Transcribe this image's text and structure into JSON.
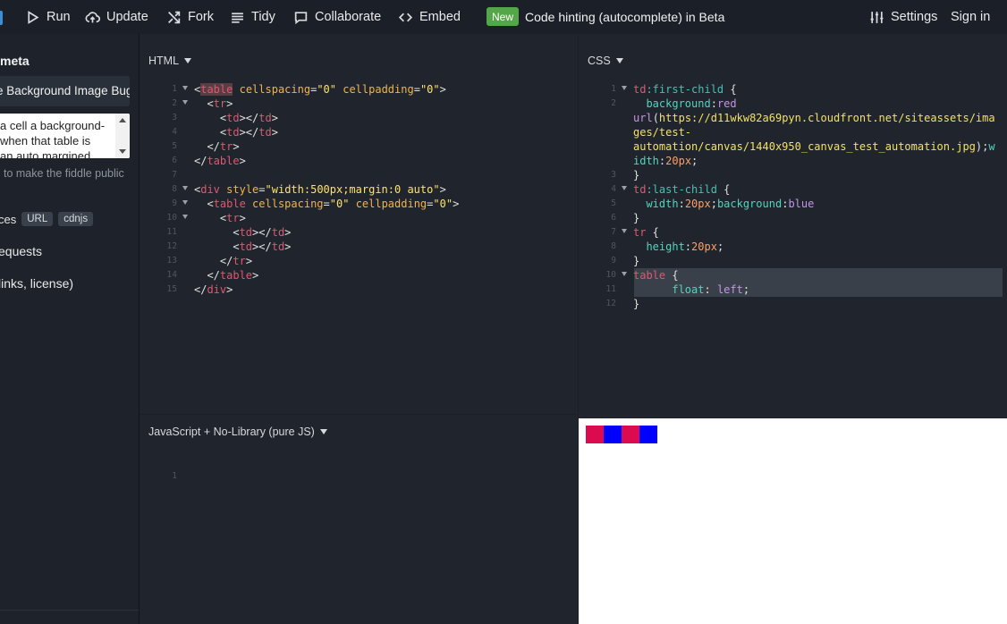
{
  "toolbar": {
    "run": "Run",
    "update": "Update",
    "fork": "Fork",
    "tidy": "Tidy",
    "collaborate": "Collaborate",
    "embed": "Embed",
    "new_badge": "New",
    "announcement": "Code hinting (autocomplete) in Beta",
    "settings": "Settings",
    "sign_in": "Sign in"
  },
  "sidebar": {
    "heading": "meta",
    "title_value": "e Background Image Bug",
    "description_lines": [
      "a cell a background-",
      "when that table is",
      "an auto margined"
    ],
    "public_note": "to make the fiddle public",
    "resources_label": "ces",
    "resource_chips": [
      "URL",
      "cdnjs"
    ],
    "requests": "equests",
    "links": "links, license)"
  },
  "html_panel": {
    "label": "HTML",
    "lines": [
      [
        [
          "t-plain",
          "<"
        ],
        [
          "t-tag hl-word",
          "table"
        ],
        [
          "t-plain",
          " "
        ],
        [
          "t-attr",
          "cellspacing"
        ],
        [
          "t-plain",
          "="
        ],
        [
          "t-str",
          "\"0\""
        ],
        [
          "t-plain",
          " "
        ],
        [
          "t-attr",
          "cellpadding"
        ],
        [
          "t-plain",
          "="
        ],
        [
          "t-str",
          "\"0\""
        ],
        [
          "t-plain",
          ">"
        ]
      ],
      [
        [
          "t-plain",
          "  <"
        ],
        [
          "t-tag",
          "tr"
        ],
        [
          "t-plain",
          ">"
        ]
      ],
      [
        [
          "t-plain",
          "    <"
        ],
        [
          "t-tag",
          "td"
        ],
        [
          "t-plain",
          "></"
        ],
        [
          "t-tag",
          "td"
        ],
        [
          "t-plain",
          ">"
        ]
      ],
      [
        [
          "t-plain",
          "    <"
        ],
        [
          "t-tag",
          "td"
        ],
        [
          "t-plain",
          "></"
        ],
        [
          "t-tag",
          "td"
        ],
        [
          "t-plain",
          ">"
        ]
      ],
      [
        [
          "t-plain",
          "  </"
        ],
        [
          "t-tag",
          "tr"
        ],
        [
          "t-plain",
          ">"
        ]
      ],
      [
        [
          "t-plain",
          "</"
        ],
        [
          "t-tag",
          "table"
        ],
        [
          "t-plain",
          ">"
        ]
      ],
      [],
      [
        [
          "t-plain",
          "<"
        ],
        [
          "t-tag",
          "div"
        ],
        [
          "t-plain",
          " "
        ],
        [
          "t-attr",
          "style"
        ],
        [
          "t-plain",
          "="
        ],
        [
          "t-str",
          "\"width:500px;margin:0 auto\""
        ],
        [
          "t-plain",
          ">"
        ]
      ],
      [
        [
          "t-plain",
          "  <"
        ],
        [
          "t-tag",
          "table"
        ],
        [
          "t-plain",
          " "
        ],
        [
          "t-attr",
          "cellspacing"
        ],
        [
          "t-plain",
          "="
        ],
        [
          "t-str",
          "\"0\""
        ],
        [
          "t-plain",
          " "
        ],
        [
          "t-attr",
          "cellpadding"
        ],
        [
          "t-plain",
          "="
        ],
        [
          "t-str",
          "\"0\""
        ],
        [
          "t-plain",
          ">"
        ]
      ],
      [
        [
          "t-plain",
          "    <"
        ],
        [
          "t-tag",
          "tr"
        ],
        [
          "t-plain",
          ">"
        ]
      ],
      [
        [
          "t-plain",
          "      <"
        ],
        [
          "t-tag",
          "td"
        ],
        [
          "t-plain",
          "></"
        ],
        [
          "t-tag",
          "td"
        ],
        [
          "t-plain",
          ">"
        ]
      ],
      [
        [
          "t-plain",
          "      <"
        ],
        [
          "t-tag",
          "td"
        ],
        [
          "t-plain",
          "></"
        ],
        [
          "t-tag",
          "td"
        ],
        [
          "t-plain",
          ">"
        ]
      ],
      [
        [
          "t-plain",
          "    </"
        ],
        [
          "t-tag",
          "tr"
        ],
        [
          "t-plain",
          ">"
        ]
      ],
      [
        [
          "t-plain",
          "  </"
        ],
        [
          "t-tag",
          "table"
        ],
        [
          "t-plain",
          ">"
        ]
      ],
      [
        [
          "t-plain",
          "</"
        ],
        [
          "t-tag",
          "div"
        ],
        [
          "t-plain",
          ">"
        ]
      ]
    ],
    "folds": [
      1,
      2,
      8,
      9,
      10
    ]
  },
  "css_panel": {
    "label": "CSS",
    "lines": [
      [
        [
          "t-sel",
          "td"
        ],
        [
          "t-pseudo",
          ":first-child"
        ],
        [
          "t-plain",
          " {"
        ]
      ],
      [
        [
          "t-prop",
          "  background"
        ],
        [
          "t-plain",
          ":"
        ],
        [
          "t-val",
          "red"
        ]
      ],
      [
        [
          "t-val",
          "url"
        ],
        [
          "t-plain",
          "("
        ],
        [
          "t-url",
          "https://d11wkw82a69pyn.cloudfront.net/siteassets/ima"
        ]
      ],
      [
        [
          "t-url",
          "ges/test-"
        ]
      ],
      [
        [
          "t-url",
          "automation/canvas/1440x950_canvas_test_automation.jpg"
        ],
        [
          "t-plain",
          ");"
        ],
        [
          "t-prop",
          "w"
        ]
      ],
      [
        [
          "t-prop",
          "idth"
        ],
        [
          "t-plain",
          ":"
        ],
        [
          "t-num",
          "20px"
        ],
        [
          "t-plain",
          ";"
        ]
      ],
      [
        [
          "t-plain",
          "}"
        ]
      ],
      [
        [
          "t-sel",
          "td"
        ],
        [
          "t-pseudo",
          ":last-child"
        ],
        [
          "t-plain",
          " {"
        ]
      ],
      [
        [
          "t-prop",
          "  width"
        ],
        [
          "t-plain",
          ":"
        ],
        [
          "t-num",
          "20px"
        ],
        [
          "t-plain",
          ";"
        ],
        [
          "t-prop",
          "background"
        ],
        [
          "t-plain",
          ":"
        ],
        [
          "t-val",
          "blue"
        ]
      ],
      [
        [
          "t-plain",
          "}"
        ]
      ],
      [
        [
          "t-sel",
          "tr"
        ],
        [
          "t-plain",
          " {"
        ]
      ],
      [
        [
          "t-prop",
          "  height"
        ],
        [
          "t-plain",
          ":"
        ],
        [
          "t-num",
          "20px"
        ],
        [
          "t-plain",
          ";"
        ]
      ],
      [
        [
          "t-plain",
          "}"
        ]
      ],
      [
        [
          "t-sel",
          "table"
        ],
        [
          "t-plain",
          " {"
        ]
      ],
      [
        [
          "t-prop",
          "      float"
        ],
        [
          "t-plain",
          ": "
        ],
        [
          "t-val",
          "left"
        ],
        [
          "t-plain",
          ";"
        ]
      ],
      [
        [
          "t-plain",
          "}"
        ]
      ]
    ],
    "line_numbers": [
      "1",
      "2",
      "",
      "",
      "",
      "",
      "3",
      "4",
      "5",
      "6",
      "7",
      "8",
      "9",
      "10",
      "11",
      "12"
    ],
    "folds_rows": [
      0,
      7,
      10,
      13
    ]
  },
  "js_panel": {
    "label": "JavaScript + No-Library (pure JS)",
    "line_numbers": [
      "1"
    ]
  },
  "result": {
    "cell_colors": [
      "#dc0a4f",
      "#0000ff",
      "#dc0a4f",
      "#0000ff"
    ]
  }
}
